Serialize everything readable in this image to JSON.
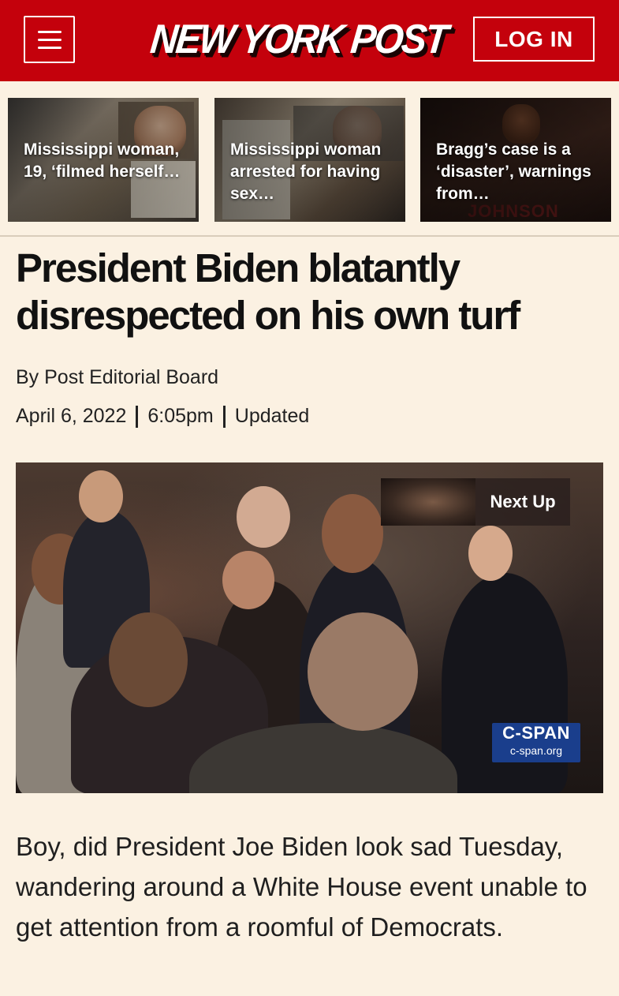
{
  "header": {
    "logo": "NEW YORK POST",
    "login_label": "LOG IN",
    "brand_color": "#c4010c"
  },
  "trending": [
    {
      "headline": "Mississippi woman, 19, ‘filmed herself…"
    },
    {
      "headline": "Mississippi woman arrested for having sex…"
    },
    {
      "headline": "Bragg’s case is a ‘disaster’, warnings from…"
    }
  ],
  "article": {
    "title": "President Biden blatantly disrespected on his own turf",
    "byline": "By Post Editorial Board",
    "date": "April 6, 2022",
    "time": "6:05pm",
    "updated": "Updated",
    "body": "Boy, did President Joe Biden look sad Tuesday, wandering around a White House event unable to get attention from a roomful of Democrats."
  },
  "video": {
    "next_up_label": "Next Up",
    "watermark_title": "C-SPAN",
    "watermark_url": "c-span.org"
  }
}
